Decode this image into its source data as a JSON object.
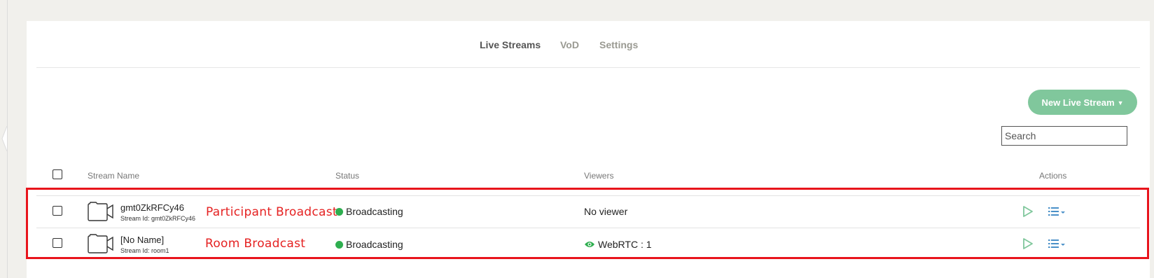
{
  "tabs": [
    {
      "label": "Live Streams",
      "active": true
    },
    {
      "label": "VoD",
      "active": false
    },
    {
      "label": "Settings",
      "active": false
    }
  ],
  "toolbar": {
    "new_stream_label": "New Live Stream",
    "search_placeholder": "Search"
  },
  "table": {
    "headers": {
      "name": "Stream Name",
      "status": "Status",
      "viewers": "Viewers",
      "actions": "Actions"
    },
    "rows": [
      {
        "name": "gmt0ZkRFCy46",
        "stream_id": "Stream Id: gmt0ZkRFCy46",
        "annotation": "Participant Broadcast",
        "status": "Broadcasting",
        "viewers": "No viewer"
      },
      {
        "name": "[No Name]",
        "stream_id": "Stream Id: room1",
        "annotation": "Room Broadcast",
        "status": "Broadcasting",
        "viewers": "WebRTC : 1"
      }
    ]
  },
  "colors": {
    "accent_green": "#80c79c",
    "status_green": "#2eae4f",
    "annotation_red": "#e8141c"
  }
}
